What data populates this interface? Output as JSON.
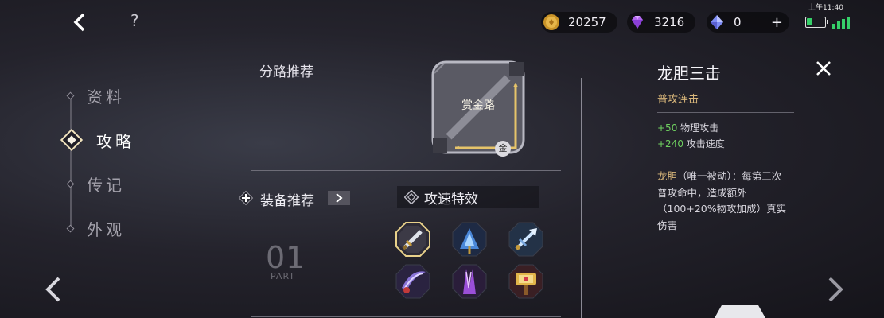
{
  "top_bar": {
    "currencies": [
      {
        "name": "gold",
        "value": "20257",
        "icon": "gold-coin-icon"
      },
      {
        "name": "gem",
        "value": "3216",
        "icon": "purple-gem-icon"
      },
      {
        "name": "crystal",
        "value": "0",
        "icon": "blue-crystal-icon",
        "add_label": "+"
      }
    ],
    "help_label": "?"
  },
  "status": {
    "time": "上午11:40",
    "battery_level": 0.35
  },
  "nav": {
    "items": [
      {
        "label": "资料",
        "active": false
      },
      {
        "label": "攻略",
        "active": true
      },
      {
        "label": "传记",
        "active": false
      },
      {
        "label": "外观",
        "active": false
      }
    ]
  },
  "lane": {
    "title": "分路推荐",
    "name": "赏金路",
    "badge": "金"
  },
  "equipment": {
    "title": "装备推荐",
    "build_name": "攻速特效",
    "part_number": "01",
    "part_label": "PART",
    "items": [
      {
        "icon": "sword-item-icon",
        "selected": true
      },
      {
        "icon": "blue-blade-item-icon",
        "selected": false
      },
      {
        "icon": "ice-spear-item-icon",
        "selected": false
      },
      {
        "icon": "crescent-blade-item-icon",
        "selected": false
      },
      {
        "icon": "purple-claw-item-icon",
        "selected": false
      },
      {
        "icon": "golden-hammer-item-icon",
        "selected": false
      }
    ]
  },
  "details": {
    "name": "龙胆三击",
    "subtitle": "普攻连击",
    "stats": [
      {
        "value": "+50",
        "label": "物理攻击"
      },
      {
        "value": "+240",
        "label": "攻击速度"
      }
    ],
    "passive_name": "龙胆",
    "passive_text": "（唯一被动）：每第三次普攻命中，造成额外（100+20%物攻加成）真实伤害"
  },
  "colors": {
    "accent_gold": "#d8b67a",
    "stat_green": "#6fd060",
    "lane_gold": "#e6c46a"
  }
}
